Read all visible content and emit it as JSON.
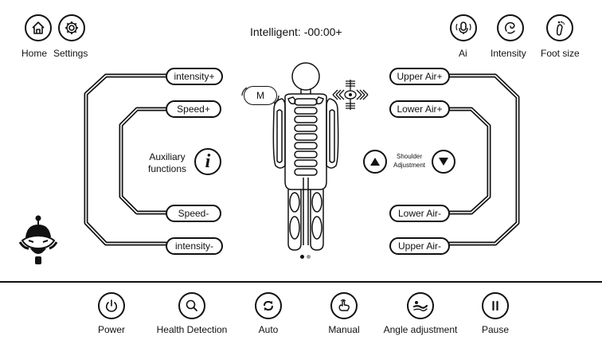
{
  "top_bar": {
    "home_label": "Home",
    "settings_label": "Settings",
    "mode_text": "Intelligent: -00:00+",
    "ai_label": "Ai",
    "intensity_label": "Intensity",
    "foot_size_label": "Foot size"
  },
  "left_panel": {
    "intensity_plus": "intensity+",
    "speed_plus": "Speed+",
    "auxiliary_label_line1": "Auxiliary",
    "auxiliary_label_line2": "functions",
    "speed_minus": "Speed-",
    "intensity_minus": "intensity-"
  },
  "center": {
    "mode_button": "M",
    "page_indicator": {
      "count": 2,
      "active": 0
    }
  },
  "right_panel": {
    "upper_air_plus": "Upper Air+",
    "lower_air_plus": "Lower Air+",
    "shoulder_label_line1": "Shoulder",
    "shoulder_label_line2": "Adjustment",
    "lower_air_minus": "Lower Air-",
    "upper_air_minus": "Upper Air-"
  },
  "bottom_nav": [
    {
      "label": "Power",
      "icon": "power-icon"
    },
    {
      "label": "Health Detection",
      "icon": "magnifier-icon"
    },
    {
      "label": "Auto",
      "icon": "auto-cycle-icon"
    },
    {
      "label": "Manual",
      "icon": "hand-press-icon"
    },
    {
      "label": "Angle adjustment",
      "icon": "recline-icon"
    },
    {
      "label": "Pause",
      "icon": "pause-icon"
    }
  ],
  "colors": {
    "line": "#111111",
    "background": "#ffffff"
  }
}
